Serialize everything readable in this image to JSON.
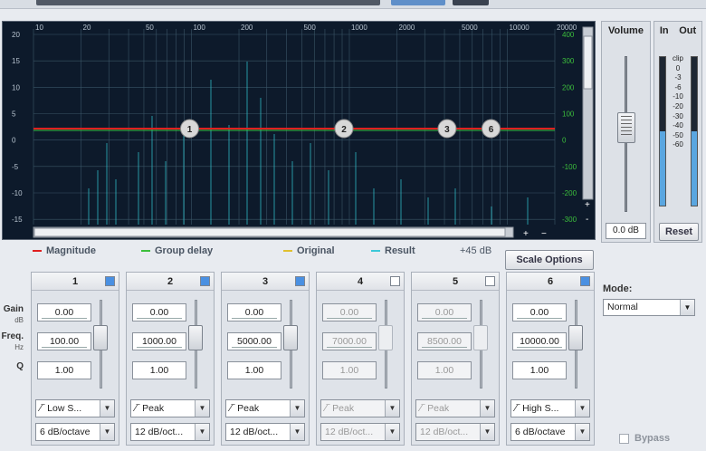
{
  "graph": {
    "freq_labels": [
      "10",
      "20",
      "50",
      "100",
      "200",
      "500",
      "1000",
      "2000",
      "5000",
      "10000",
      "20000"
    ],
    "gain_labels": [
      "20",
      "15",
      "10",
      "5",
      "0",
      "-5",
      "-10",
      "-15"
    ],
    "delay_labels": [
      "400",
      "300",
      "200",
      "100",
      "0",
      "-100",
      "-200",
      "-300"
    ],
    "nodes": [
      "1",
      "2",
      "3",
      "6"
    ],
    "zoom_in": "+",
    "zoom_out": "-",
    "hscroll_plus": "+",
    "hscroll_minus": "−"
  },
  "legend": {
    "magnitude": "Magnitude",
    "group_delay": "Group delay",
    "original": "Original",
    "result": "Result",
    "range": "+45 dB",
    "colors": {
      "magnitude": "#e02020",
      "group_delay": "#3cbf3c",
      "original": "#e0c030",
      "result": "#3cc8d8"
    }
  },
  "scale_options_label": "Scale Options",
  "row_labels": {
    "gain": "Gain",
    "gain_unit": "dB",
    "freq": "Freq.",
    "freq_unit": "Hz",
    "q": "Q"
  },
  "volume": {
    "title": "Volume",
    "value": "0.0 dB"
  },
  "meter": {
    "in": "In",
    "out": "Out",
    "scale": [
      "clip",
      "0",
      "-3",
      "-6",
      "-10",
      "-20",
      "-30",
      "-40",
      "-50",
      "-60"
    ],
    "reset": "Reset"
  },
  "mode": {
    "label": "Mode:",
    "value": "Normal"
  },
  "bypass": "Bypass",
  "bands": [
    {
      "num": "1",
      "enabled": true,
      "gain": "0.00",
      "freq": "100.00",
      "q": "1.00",
      "type": "Low S...",
      "slope": "6 dB/octave"
    },
    {
      "num": "2",
      "enabled": true,
      "gain": "0.00",
      "freq": "1000.00",
      "q": "1.00",
      "type": "Peak",
      "slope": "12 dB/oct..."
    },
    {
      "num": "3",
      "enabled": true,
      "gain": "0.00",
      "freq": "5000.00",
      "q": "1.00",
      "type": "Peak",
      "slope": "12 dB/oct..."
    },
    {
      "num": "4",
      "enabled": false,
      "gain": "0.00",
      "freq": "7000.00",
      "q": "1.00",
      "type": "Peak",
      "slope": "12 dB/oct..."
    },
    {
      "num": "5",
      "enabled": false,
      "gain": "0.00",
      "freq": "8500.00",
      "q": "1.00",
      "type": "Peak",
      "slope": "12 dB/oct..."
    },
    {
      "num": "6",
      "enabled": true,
      "gain": "0.00",
      "freq": "10000.00",
      "q": "1.00",
      "type": "High S...",
      "slope": "6 dB/octave"
    }
  ]
}
